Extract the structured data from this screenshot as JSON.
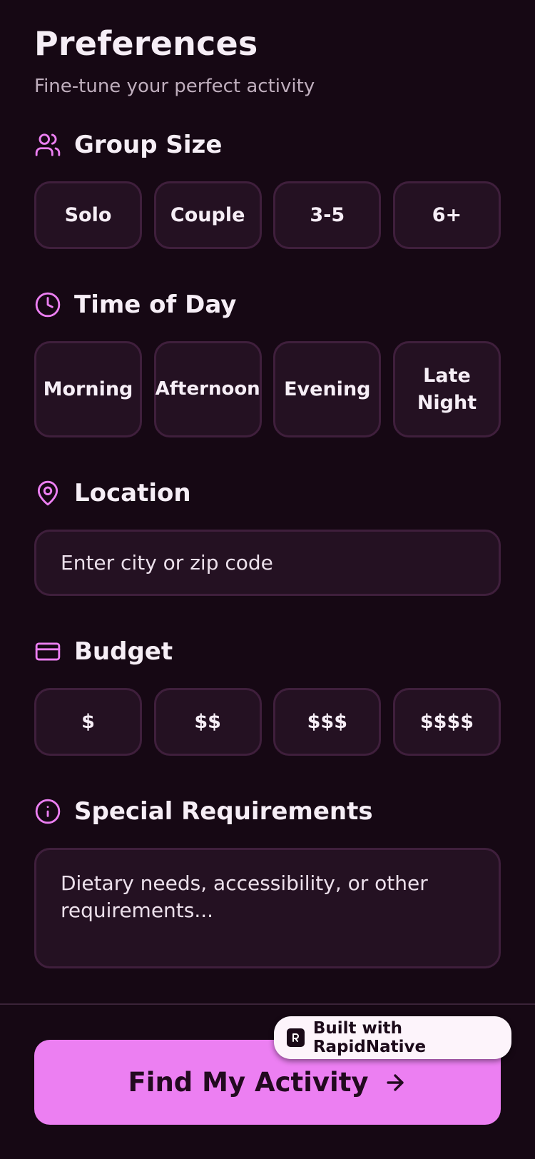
{
  "header": {
    "title": "Preferences",
    "subtitle": "Fine-tune your perfect activity"
  },
  "sections": {
    "group_size": {
      "label": "Group Size",
      "icon": "users-icon",
      "options": [
        "Solo",
        "Couple",
        "3-5",
        "6+"
      ]
    },
    "time_of_day": {
      "label": "Time of Day",
      "icon": "clock-icon",
      "options": [
        "Morning",
        "Afternoon",
        "Evening",
        "Late Night"
      ]
    },
    "location": {
      "label": "Location",
      "icon": "map-pin-icon",
      "placeholder": "Enter city or zip code"
    },
    "budget": {
      "label": "Budget",
      "icon": "credit-card-icon",
      "options": [
        "$",
        "$$",
        "$$$",
        "$$$$"
      ]
    },
    "special_requirements": {
      "label": "Special Requirements",
      "icon": "info-icon",
      "placeholder": "Dietary needs, accessibility, or other requirements..."
    }
  },
  "cta": {
    "label": "Find My Activity",
    "icon": "arrow-right-icon"
  },
  "badge": {
    "label": "Built with RapidNative",
    "icon": "rapidnative-logo-icon"
  },
  "colors": {
    "background": "#160814",
    "accent": "#ec7ff2",
    "chip_background": "#241122",
    "chip_border": "#3f1f3c",
    "subtitle_text": "#bfaebd"
  }
}
